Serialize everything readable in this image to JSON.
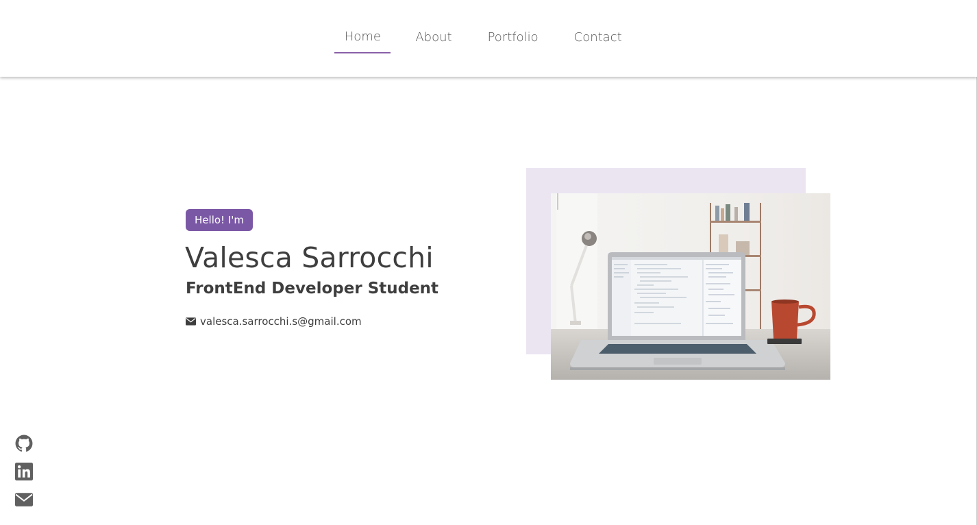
{
  "nav": {
    "items": [
      {
        "label": "Home",
        "active": true
      },
      {
        "label": "About"
      },
      {
        "label": "Portfolio"
      },
      {
        "label": "Contact"
      }
    ]
  },
  "hero": {
    "badge": "Hello! I'm",
    "name": "Valesca Sarrocchi",
    "role": "FrontEnd Developer Student",
    "email": "valesca.sarrocchi.s@gmail.com",
    "image_alt": "laptop-on-desk-photo"
  },
  "social": {
    "icons": [
      "github-icon",
      "linkedin-icon",
      "envelope-icon"
    ]
  },
  "colors": {
    "accent": "#7b58a6",
    "underline": "#8a5fa8",
    "backdrop": "#ebe5f2",
    "text": "#3e3e3e"
  }
}
